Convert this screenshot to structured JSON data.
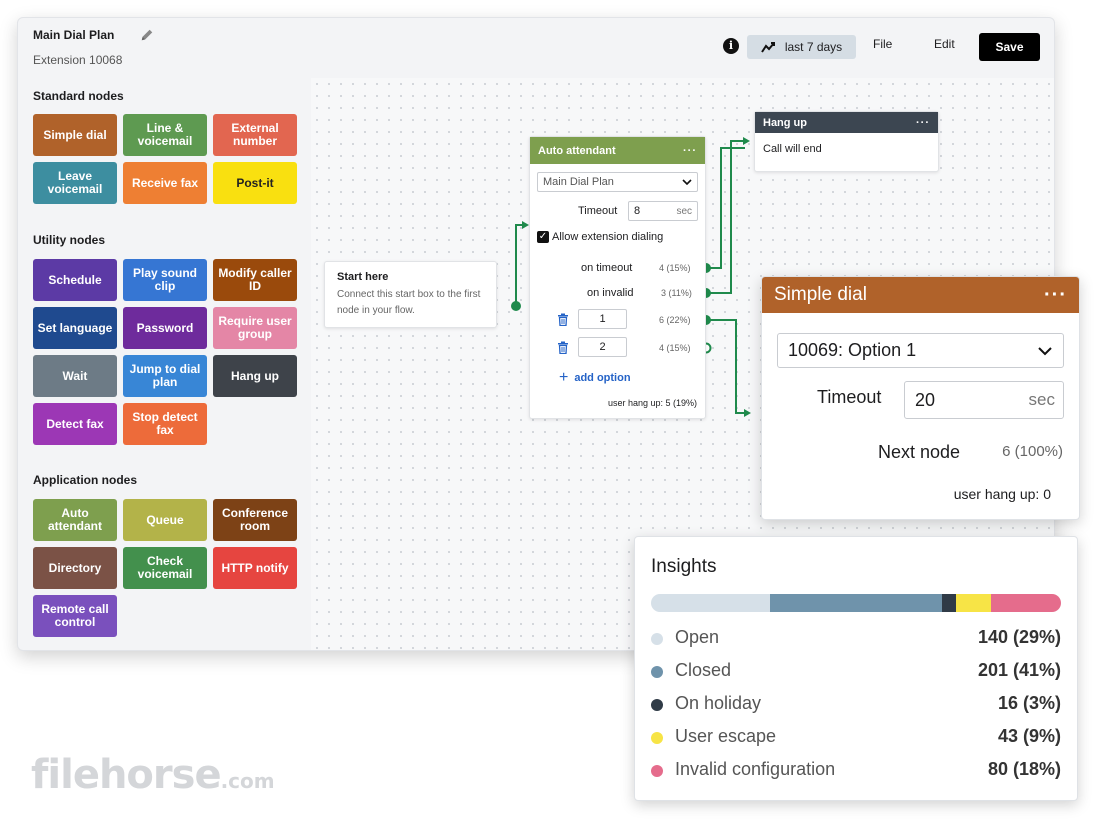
{
  "header": {
    "plan_title": "Main Dial Plan",
    "extension": "Extension 10068",
    "range_label": "last 7 days",
    "file_label": "File",
    "edit_label": "Edit",
    "save_label": "Save"
  },
  "sidebar": {
    "sections": [
      {
        "title": "Standard nodes",
        "nodes": [
          {
            "label": "Simple dial",
            "color": "#b0622a"
          },
          {
            "label": "Line & voicemail",
            "color": "#5e9a51"
          },
          {
            "label": "External number",
            "color": "#e26650"
          },
          {
            "label": "Leave voicemail",
            "color": "#3d8ea0"
          },
          {
            "label": "Receive fax",
            "color": "#ee7f33"
          },
          {
            "label": "Post-it",
            "color": "#f9e010",
            "text_color": "#222222"
          }
        ]
      },
      {
        "title": "Utility nodes",
        "nodes": [
          {
            "label": "Schedule",
            "color": "#5c3aa5"
          },
          {
            "label": "Play sound clip",
            "color": "#3676d3"
          },
          {
            "label": "Modify caller ID",
            "color": "#9a4a0c"
          },
          {
            "label": "Set language",
            "color": "#1f4a8f"
          },
          {
            "label": "Password",
            "color": "#6e2b9c"
          },
          {
            "label": "Require user group",
            "color": "#e486a6"
          },
          {
            "label": "Wait",
            "color": "#6d7b86"
          },
          {
            "label": "Jump to dial plan",
            "color": "#3886d6"
          },
          {
            "label": "Hang up",
            "color": "#3e434a"
          },
          {
            "label": "Detect fax",
            "color": "#9c37b5"
          },
          {
            "label": "Stop detect fax",
            "color": "#ed6b3a"
          }
        ]
      },
      {
        "title": "Application nodes",
        "nodes": [
          {
            "label": "Auto attendant",
            "color": "#7e9f4e"
          },
          {
            "label": "Queue",
            "color": "#b3b349"
          },
          {
            "label": "Conference room",
            "color": "#7d4216"
          },
          {
            "label": "Directory",
            "color": "#7b5246"
          },
          {
            "label": "Check voicemail",
            "color": "#43904d"
          },
          {
            "label": "HTTP notify",
            "color": "#e64540"
          },
          {
            "label": "Remote call control",
            "color": "#7a50bd"
          }
        ]
      }
    ]
  },
  "start_node": {
    "title": "Start here",
    "text": "Connect this start box to the first node in your flow."
  },
  "auto_attendant": {
    "title": "Auto attendant",
    "menu_icon": "three-dots-icon",
    "dial_plan": "Main Dial Plan",
    "timeout_label": "Timeout",
    "timeout_value": "8",
    "timeout_unit": "sec",
    "allow_ext_label": "Allow extension dialing",
    "on_timeout_label": "on timeout",
    "on_timeout_count": "4 (15%)",
    "on_invalid_label": "on invalid",
    "on_invalid_count": "3 (11%)",
    "options": [
      {
        "value": "1",
        "count": "6 (22%)"
      },
      {
        "value": "2",
        "count": "4 (15%)"
      }
    ],
    "add_option_label": "add option",
    "user_hang_up": "user hang up: 5 (19%)"
  },
  "hang_up_node": {
    "title": "Hang up",
    "text": "Call will end"
  },
  "simple_dial": {
    "title": "Simple dial",
    "selected": "10069: Option 1",
    "timeout_label": "Timeout",
    "timeout_value": "20",
    "timeout_unit": "sec",
    "next_node_label": "Next node",
    "next_node_count": "6 (100%)",
    "user_hang_up": "user hang up: 0"
  },
  "insights": {
    "title": "Insights",
    "items": [
      {
        "label": "Open",
        "value": "140 (29%)",
        "share": 0.29,
        "color": "#d6e0e8"
      },
      {
        "label": "Closed",
        "value": "201 (41%)",
        "share": 0.42,
        "color": "#6f93ab"
      },
      {
        "label": "On holiday",
        "value": "16 (3%)",
        "share": 0.035,
        "color": "#303b47"
      },
      {
        "label": "User escape",
        "value": "43 (9%)",
        "share": 0.085,
        "color": "#f7e446"
      },
      {
        "label": "Invalid configuration",
        "value": "80 (18%)",
        "share": 0.17,
        "color": "#e56c8c"
      }
    ]
  },
  "watermark": {
    "brand": "filehorse",
    "suffix": ".com"
  },
  "colors": {
    "wire": "#1f8a4c",
    "primary_action": "#000000",
    "link": "#2563c7"
  }
}
